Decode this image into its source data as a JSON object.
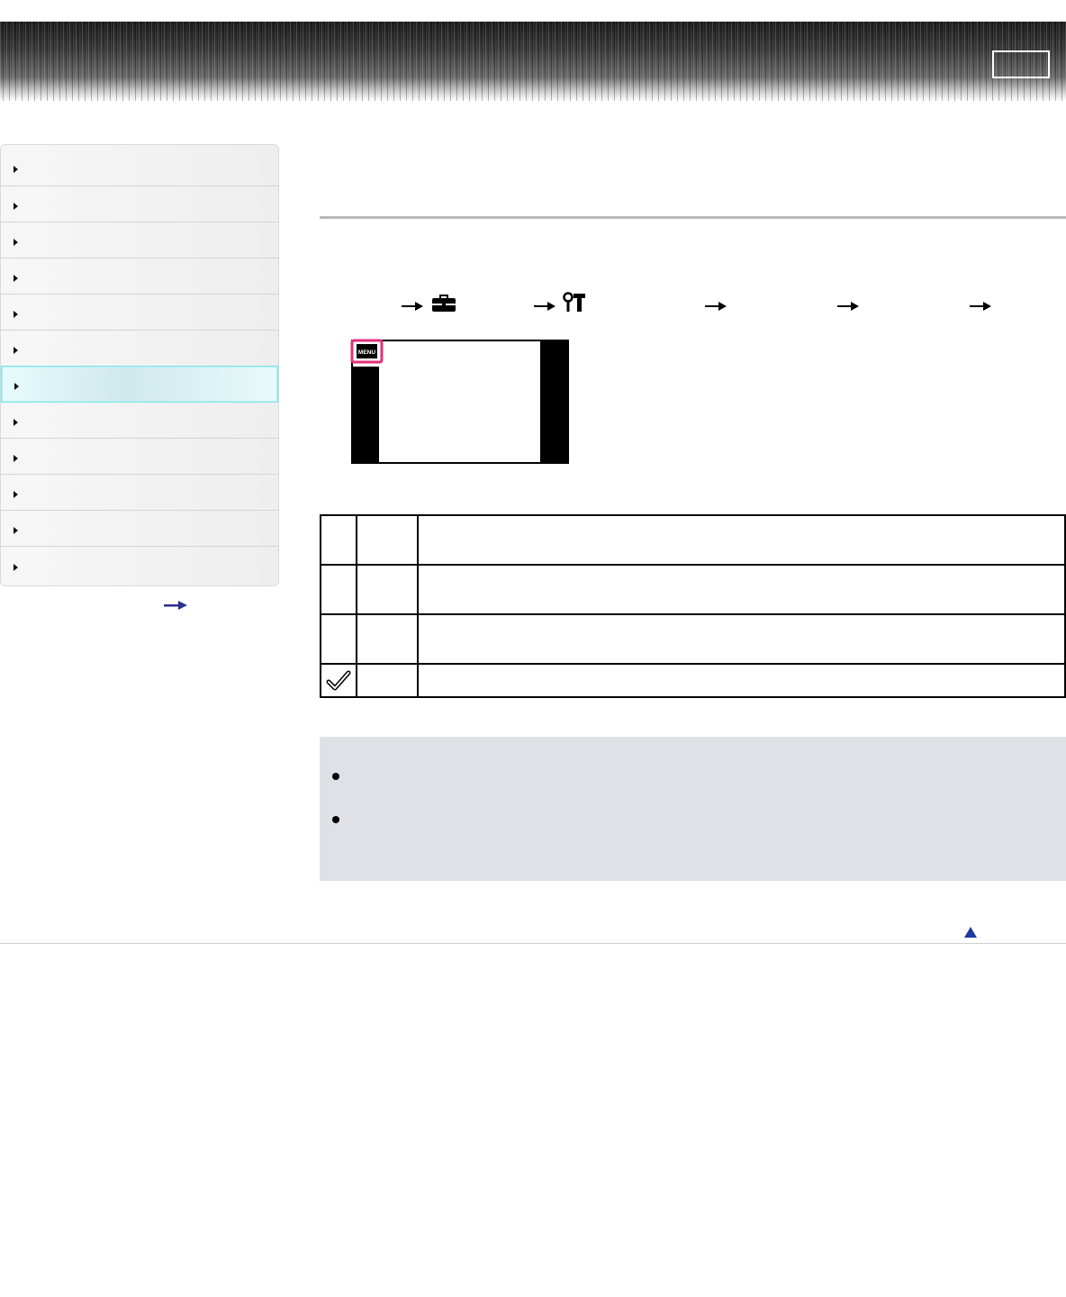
{
  "header": {
    "accent_color": "#3a3a3a",
    "button_label": ""
  },
  "sidebar": {
    "items": [
      {
        "label": ""
      },
      {
        "label": ""
      },
      {
        "label": ""
      },
      {
        "label": ""
      },
      {
        "label": ""
      },
      {
        "label": ""
      },
      {
        "label": "",
        "active": true
      },
      {
        "label": ""
      },
      {
        "label": ""
      },
      {
        "label": ""
      },
      {
        "label": ""
      },
      {
        "label": ""
      }
    ],
    "more_link_icon": "right-arrow-icon",
    "active_color": "#7fe2ec"
  },
  "main": {
    "menu_path": {
      "icons": [
        "right-arrow-icon",
        "toolbox-icon",
        "right-arrow-icon",
        "wrench-icon",
        "right-arrow-icon",
        "right-arrow-icon",
        "right-arrow-icon"
      ]
    },
    "screen_figure": {
      "menu_button_label": "MENU",
      "highlight_color": "#e0307a"
    },
    "settings_table": {
      "rows": [
        {
          "icon": "",
          "name": "",
          "description": "",
          "default": false
        },
        {
          "icon": "",
          "name": "",
          "description": "",
          "default": false
        },
        {
          "icon": "",
          "name": "",
          "description": "",
          "default": false
        },
        {
          "icon": "checkmark-icon",
          "name": "",
          "description": "",
          "default": true
        }
      ]
    },
    "notes": {
      "bullets": [
        {
          "text": ""
        },
        {
          "text": ""
        }
      ],
      "background": "#dfe1e6"
    },
    "page_top_icon": "up-triangle-icon"
  }
}
